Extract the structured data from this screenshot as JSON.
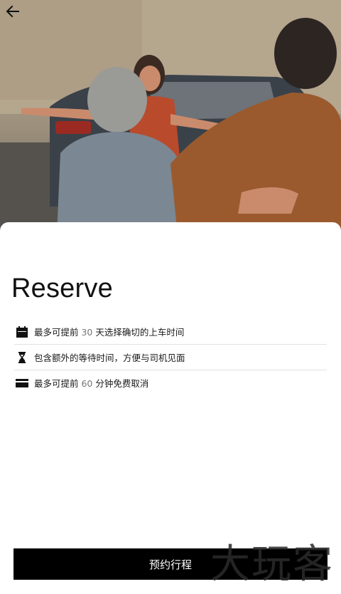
{
  "header": {
    "back_icon": "arrow-left-icon"
  },
  "hero": {
    "description_icon": "photo-illustration"
  },
  "main": {
    "title": "Reserve",
    "features": [
      {
        "icon": "calendar-icon",
        "text_before": "最多可提前 ",
        "number": "30",
        "text_after": " 天选择确切的上车时间"
      },
      {
        "icon": "hourglass-icon",
        "text_before": "包含额外的等待时间，方便与司机见面",
        "number": "",
        "text_after": ""
      },
      {
        "icon": "card-icon",
        "text_before": "最多可提前 ",
        "number": "60",
        "text_after": " 分钟免费取消"
      }
    ],
    "cta_label": "预约行程"
  },
  "watermark": {
    "text": "大玩客"
  },
  "colors": {
    "cta_bg": "#000000",
    "text": "#111111",
    "number": "#777777",
    "divider": "#e2e2e2"
  }
}
